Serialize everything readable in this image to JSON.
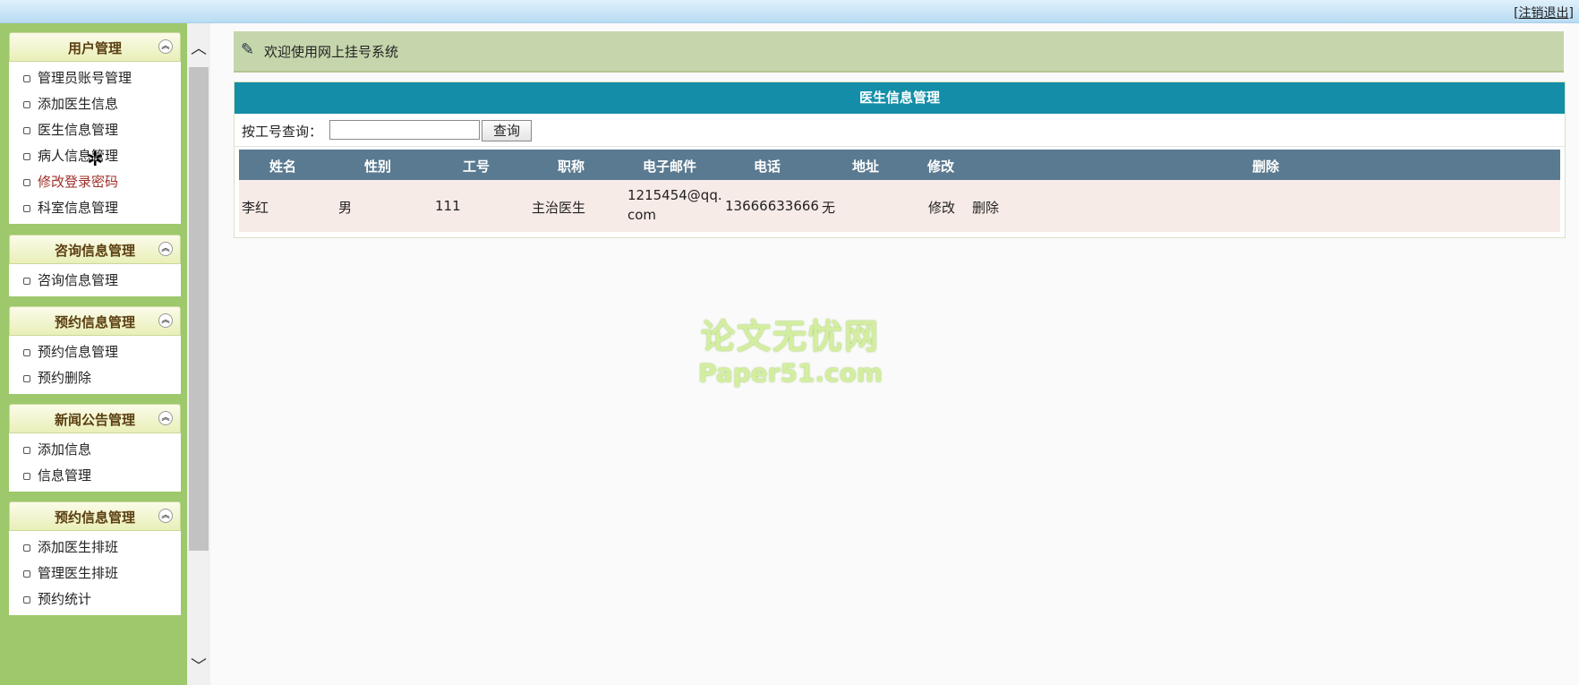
{
  "topbar": {
    "logout": "[注销退出]"
  },
  "sidebar": {
    "groups": [
      {
        "title": "用户管理",
        "items": [
          "管理员账号管理",
          "添加医生信息",
          "医生信息管理",
          "病人信息管理",
          "修改登录密码",
          "科室信息管理"
        ]
      },
      {
        "title": "咨询信息管理",
        "items": [
          "咨询信息管理"
        ]
      },
      {
        "title": "预约信息管理",
        "items": [
          "预约信息管理",
          "预约删除"
        ]
      },
      {
        "title": "新闻公告管理",
        "items": [
          "添加信息",
          "信息管理"
        ]
      },
      {
        "title": "预约信息管理",
        "items": [
          "添加医生排班",
          "管理医生排班",
          "预约统计"
        ]
      }
    ]
  },
  "welcome": {
    "text": "欢迎使用网上挂号系统"
  },
  "panel": {
    "title": "医生信息管理",
    "search_label": "按工号查询：",
    "search_value": "",
    "search_button": "查询",
    "headers": [
      "姓名",
      "性别",
      "工号",
      "职称",
      "电子邮件",
      "电话",
      "地址",
      "修改",
      "删除"
    ],
    "rows": [
      {
        "name": "李红",
        "gender": "男",
        "id": "111",
        "title": "主治医生",
        "email": "1215454@qq.com",
        "phone": "13666633666",
        "address": "无",
        "edit": "修改",
        "delete": "删除"
      }
    ]
  },
  "watermark": {
    "line1": "论文无忧网",
    "line2": "Paper51.com"
  }
}
